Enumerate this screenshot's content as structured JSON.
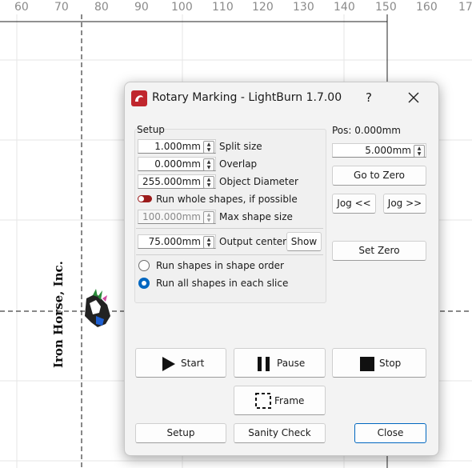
{
  "ruler": {
    "ticks": [
      "60",
      "70",
      "80",
      "90",
      "100",
      "110",
      "120",
      "130",
      "140",
      "150",
      "160",
      "17"
    ]
  },
  "artwork": {
    "company_text": "Iron Horse, Inc."
  },
  "dialog": {
    "title": "Rotary Marking - LightBurn 1.7.00",
    "help_label": "?",
    "setup_group": {
      "title": "Setup",
      "split_size": {
        "value": "1.000mm",
        "label": "Split size"
      },
      "overlap": {
        "value": "0.000mm",
        "label": "Overlap"
      },
      "object_diameter": {
        "value": "255.000mm",
        "label": "Object Diameter"
      },
      "run_whole_shapes": {
        "label": "Run whole shapes, if possible",
        "checked": true
      },
      "max_shape_size": {
        "value": "100.000mm",
        "label": "Max shape size"
      },
      "output_center": {
        "value": "75.000mm",
        "label": "Output center"
      },
      "show_button": "Show",
      "order_options": [
        {
          "label": "Run shapes in shape order",
          "selected": false
        },
        {
          "label": "Run all shapes in each slice",
          "selected": true
        }
      ]
    },
    "position": {
      "pos_label": "Pos: 0.000mm",
      "jog_distance": "5.000mm",
      "go_to_zero": "Go to Zero",
      "jog_back": "Jog <<",
      "jog_forward": "Jog >>",
      "set_zero": "Set Zero"
    },
    "controls": {
      "start": "Start",
      "pause": "Pause",
      "stop": "Stop",
      "frame": "Frame"
    },
    "footer": {
      "setup": "Setup",
      "sanity_check": "Sanity Check",
      "close": "Close"
    },
    "colors": {
      "accent": "#0067c0",
      "toggle": "#9b1b1b",
      "dialog_bg": "#f3f3f3"
    }
  }
}
